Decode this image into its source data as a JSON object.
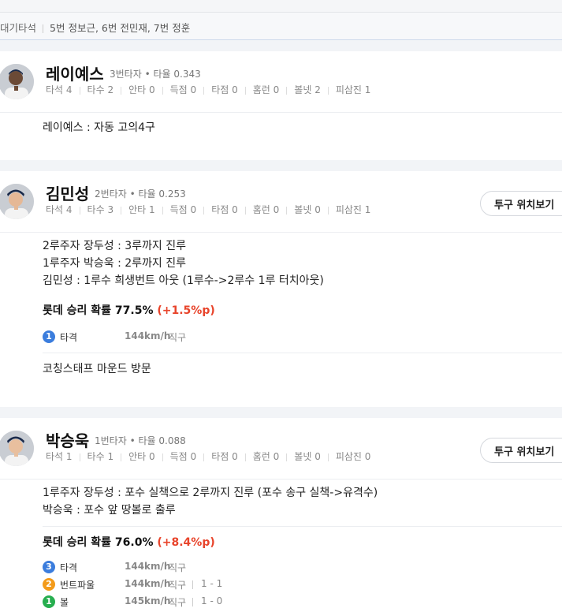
{
  "waiting": {
    "label": "대기타석",
    "text": "5번 정보근, 6번 전민재, 7번 정훈"
  },
  "stat_labels": [
    "타석",
    "타수",
    "안타",
    "득점",
    "타점",
    "홈런",
    "볼넷",
    "피삼진"
  ],
  "pitch_button_label": "투구 위치보기",
  "players": [
    {
      "name": "레이예스",
      "order": "3번타자",
      "avg_label": "타율",
      "avg": "0.343",
      "stats": [
        "4",
        "2",
        "0",
        "0",
        "0",
        "0",
        "2",
        "1"
      ],
      "events": [
        "레이예스 : 자동 고의4구"
      ]
    },
    {
      "name": "김민성",
      "order": "2번타자",
      "avg_label": "타율",
      "avg": "0.253",
      "stats": [
        "4",
        "3",
        "1",
        "0",
        "0",
        "0",
        "0",
        "1"
      ],
      "events": [
        "2루주자 장두성 : 3루까지 진루",
        "1루주자 박승욱 : 2루까지 진루",
        "김민성 : 1루수 희생번트 아웃 (1루수->2루수 1루 터치아웃)"
      ],
      "win_prob": {
        "label": "롯데 승리 확률",
        "value": "77.5%",
        "delta": "(+1.5%p)"
      },
      "pitches": [
        {
          "num": "1",
          "color": "#3b7ddd",
          "result": "타격",
          "speed": "144km/h",
          "type": "직구",
          "count": ""
        }
      ],
      "note": "코칭스태프 마운드 방문"
    },
    {
      "name": "박승욱",
      "order": "1번타자",
      "avg_label": "타율",
      "avg": "0.088",
      "stats": [
        "1",
        "1",
        "0",
        "0",
        "0",
        "0",
        "0",
        "0"
      ],
      "events": [
        "1루주자 장두성 : 포수 실책으로 2루까지 진루 (포수 송구 실책->유격수)",
        "박승욱 : 포수 앞 땅볼로 출루"
      ],
      "win_prob": {
        "label": "롯데 승리 확률",
        "value": "76.0%",
        "delta": "(+8.4%p)"
      },
      "pitches": [
        {
          "num": "3",
          "color": "#3b7ddd",
          "result": "타격",
          "speed": "144km/h",
          "type": "직구",
          "count": ""
        },
        {
          "num": "2",
          "color": "#f39b1a",
          "result": "번트파울",
          "speed": "144km/h",
          "type": "직구",
          "count": "1 - 1"
        },
        {
          "num": "1",
          "color": "#27ae4f",
          "result": "볼",
          "speed": "145km/h",
          "type": "직구",
          "count": "1 - 0"
        }
      ]
    }
  ]
}
